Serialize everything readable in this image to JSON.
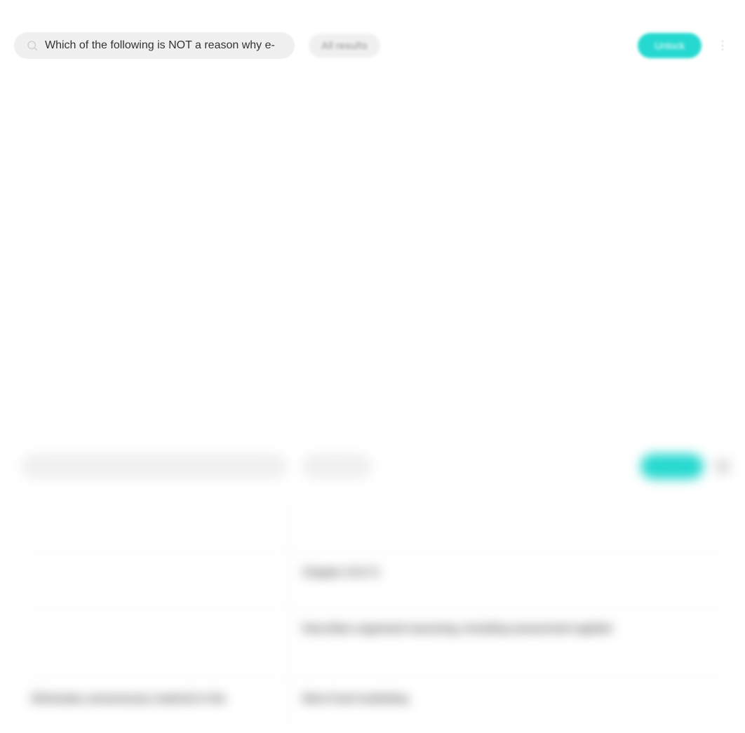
{
  "topbar": {
    "search_value": "Which of the following is NOT a reason why e-",
    "search_placeholder": "Search",
    "filter_label": "All results",
    "action_label": "Unlock",
    "menu_label": "menu"
  },
  "table": {
    "rows": [
      {
        "left": "",
        "right": ""
      },
      {
        "left": "",
        "right": "Chapter 4/5/13"
      },
      {
        "left": "",
        "right": "Describes organized reasoning, including assessment applied"
      },
      {
        "left": "Eliminates unnecessary material in the",
        "right": "More food marketing"
      }
    ]
  }
}
